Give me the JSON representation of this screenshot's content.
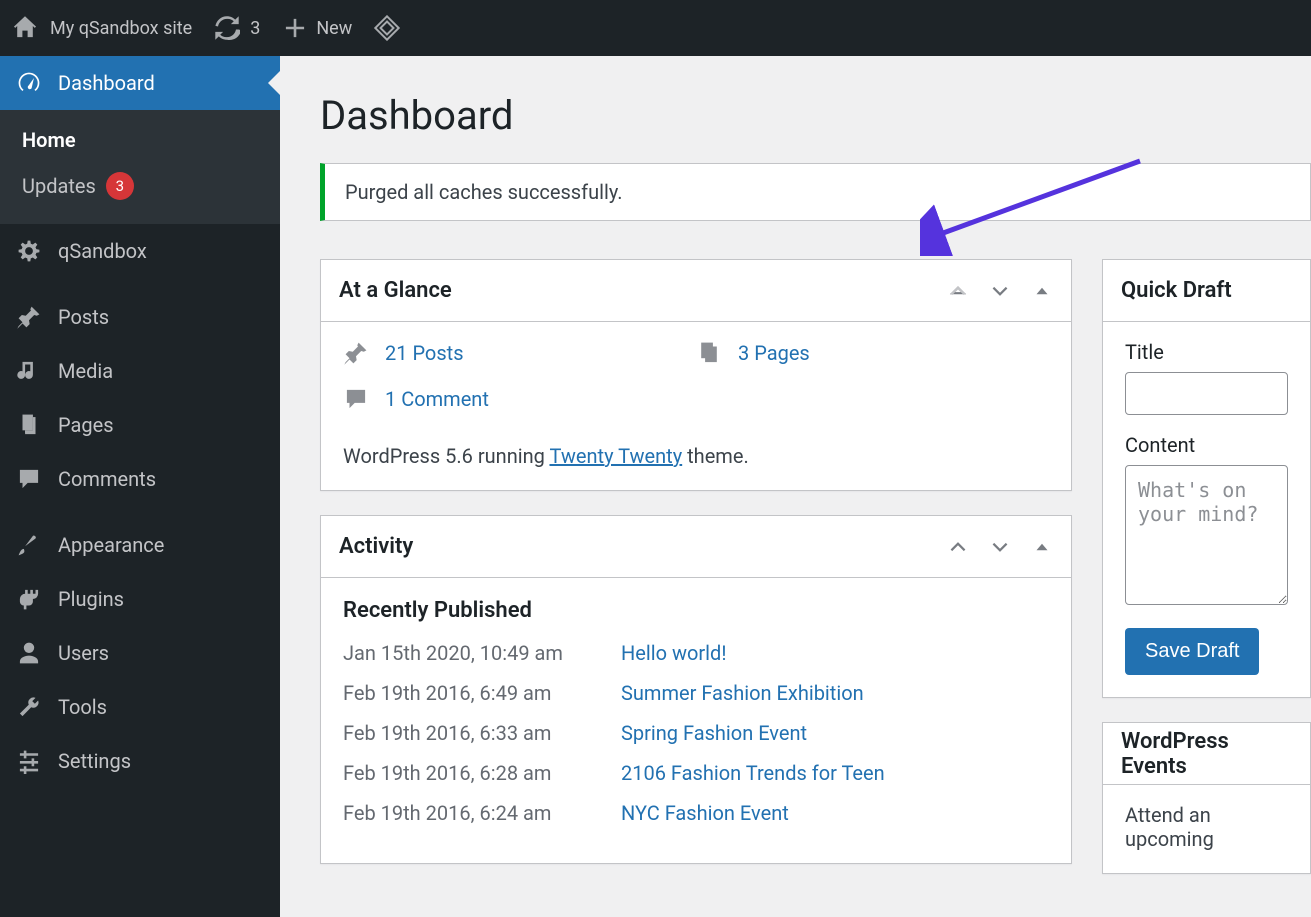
{
  "adminbar": {
    "site_name": "My qSandbox site",
    "refresh_count": "3",
    "new_label": "New"
  },
  "sidebar": {
    "dashboard": "Dashboard",
    "submenu": {
      "home": "Home",
      "updates": "Updates",
      "updates_count": "3"
    },
    "qsandbox": "qSandbox",
    "posts": "Posts",
    "media": "Media",
    "pages": "Pages",
    "comments": "Comments",
    "appearance": "Appearance",
    "plugins": "Plugins",
    "users": "Users",
    "tools": "Tools",
    "settings": "Settings"
  },
  "main": {
    "title": "Dashboard",
    "notice": "Purged all caches successfully."
  },
  "glance": {
    "title": "At a Glance",
    "posts": "21 Posts",
    "pages": "3 Pages",
    "comments": "1 Comment",
    "version_prefix": "WordPress 5.6 running ",
    "theme": "Twenty Twenty",
    "version_suffix": " theme."
  },
  "activity": {
    "title": "Activity",
    "subtitle": "Recently Published",
    "rows": [
      {
        "date": "Jan 15th 2020, 10:49 am",
        "title": "Hello world!"
      },
      {
        "date": "Feb 19th 2016, 6:49 am",
        "title": "Summer Fashion Exhibition"
      },
      {
        "date": "Feb 19th 2016, 6:33 am",
        "title": "Spring Fashion Event"
      },
      {
        "date": "Feb 19th 2016, 6:28 am",
        "title": "2106 Fashion Trends for Teen"
      },
      {
        "date": "Feb 19th 2016, 6:24 am",
        "title": "NYC Fashion Event"
      }
    ]
  },
  "quickdraft": {
    "title": "Quick Draft",
    "title_label": "Title",
    "content_label": "Content",
    "content_placeholder": "What's on your mind?",
    "save": "Save Draft"
  },
  "events": {
    "title": "WordPress Events",
    "text": "Attend an upcoming"
  }
}
